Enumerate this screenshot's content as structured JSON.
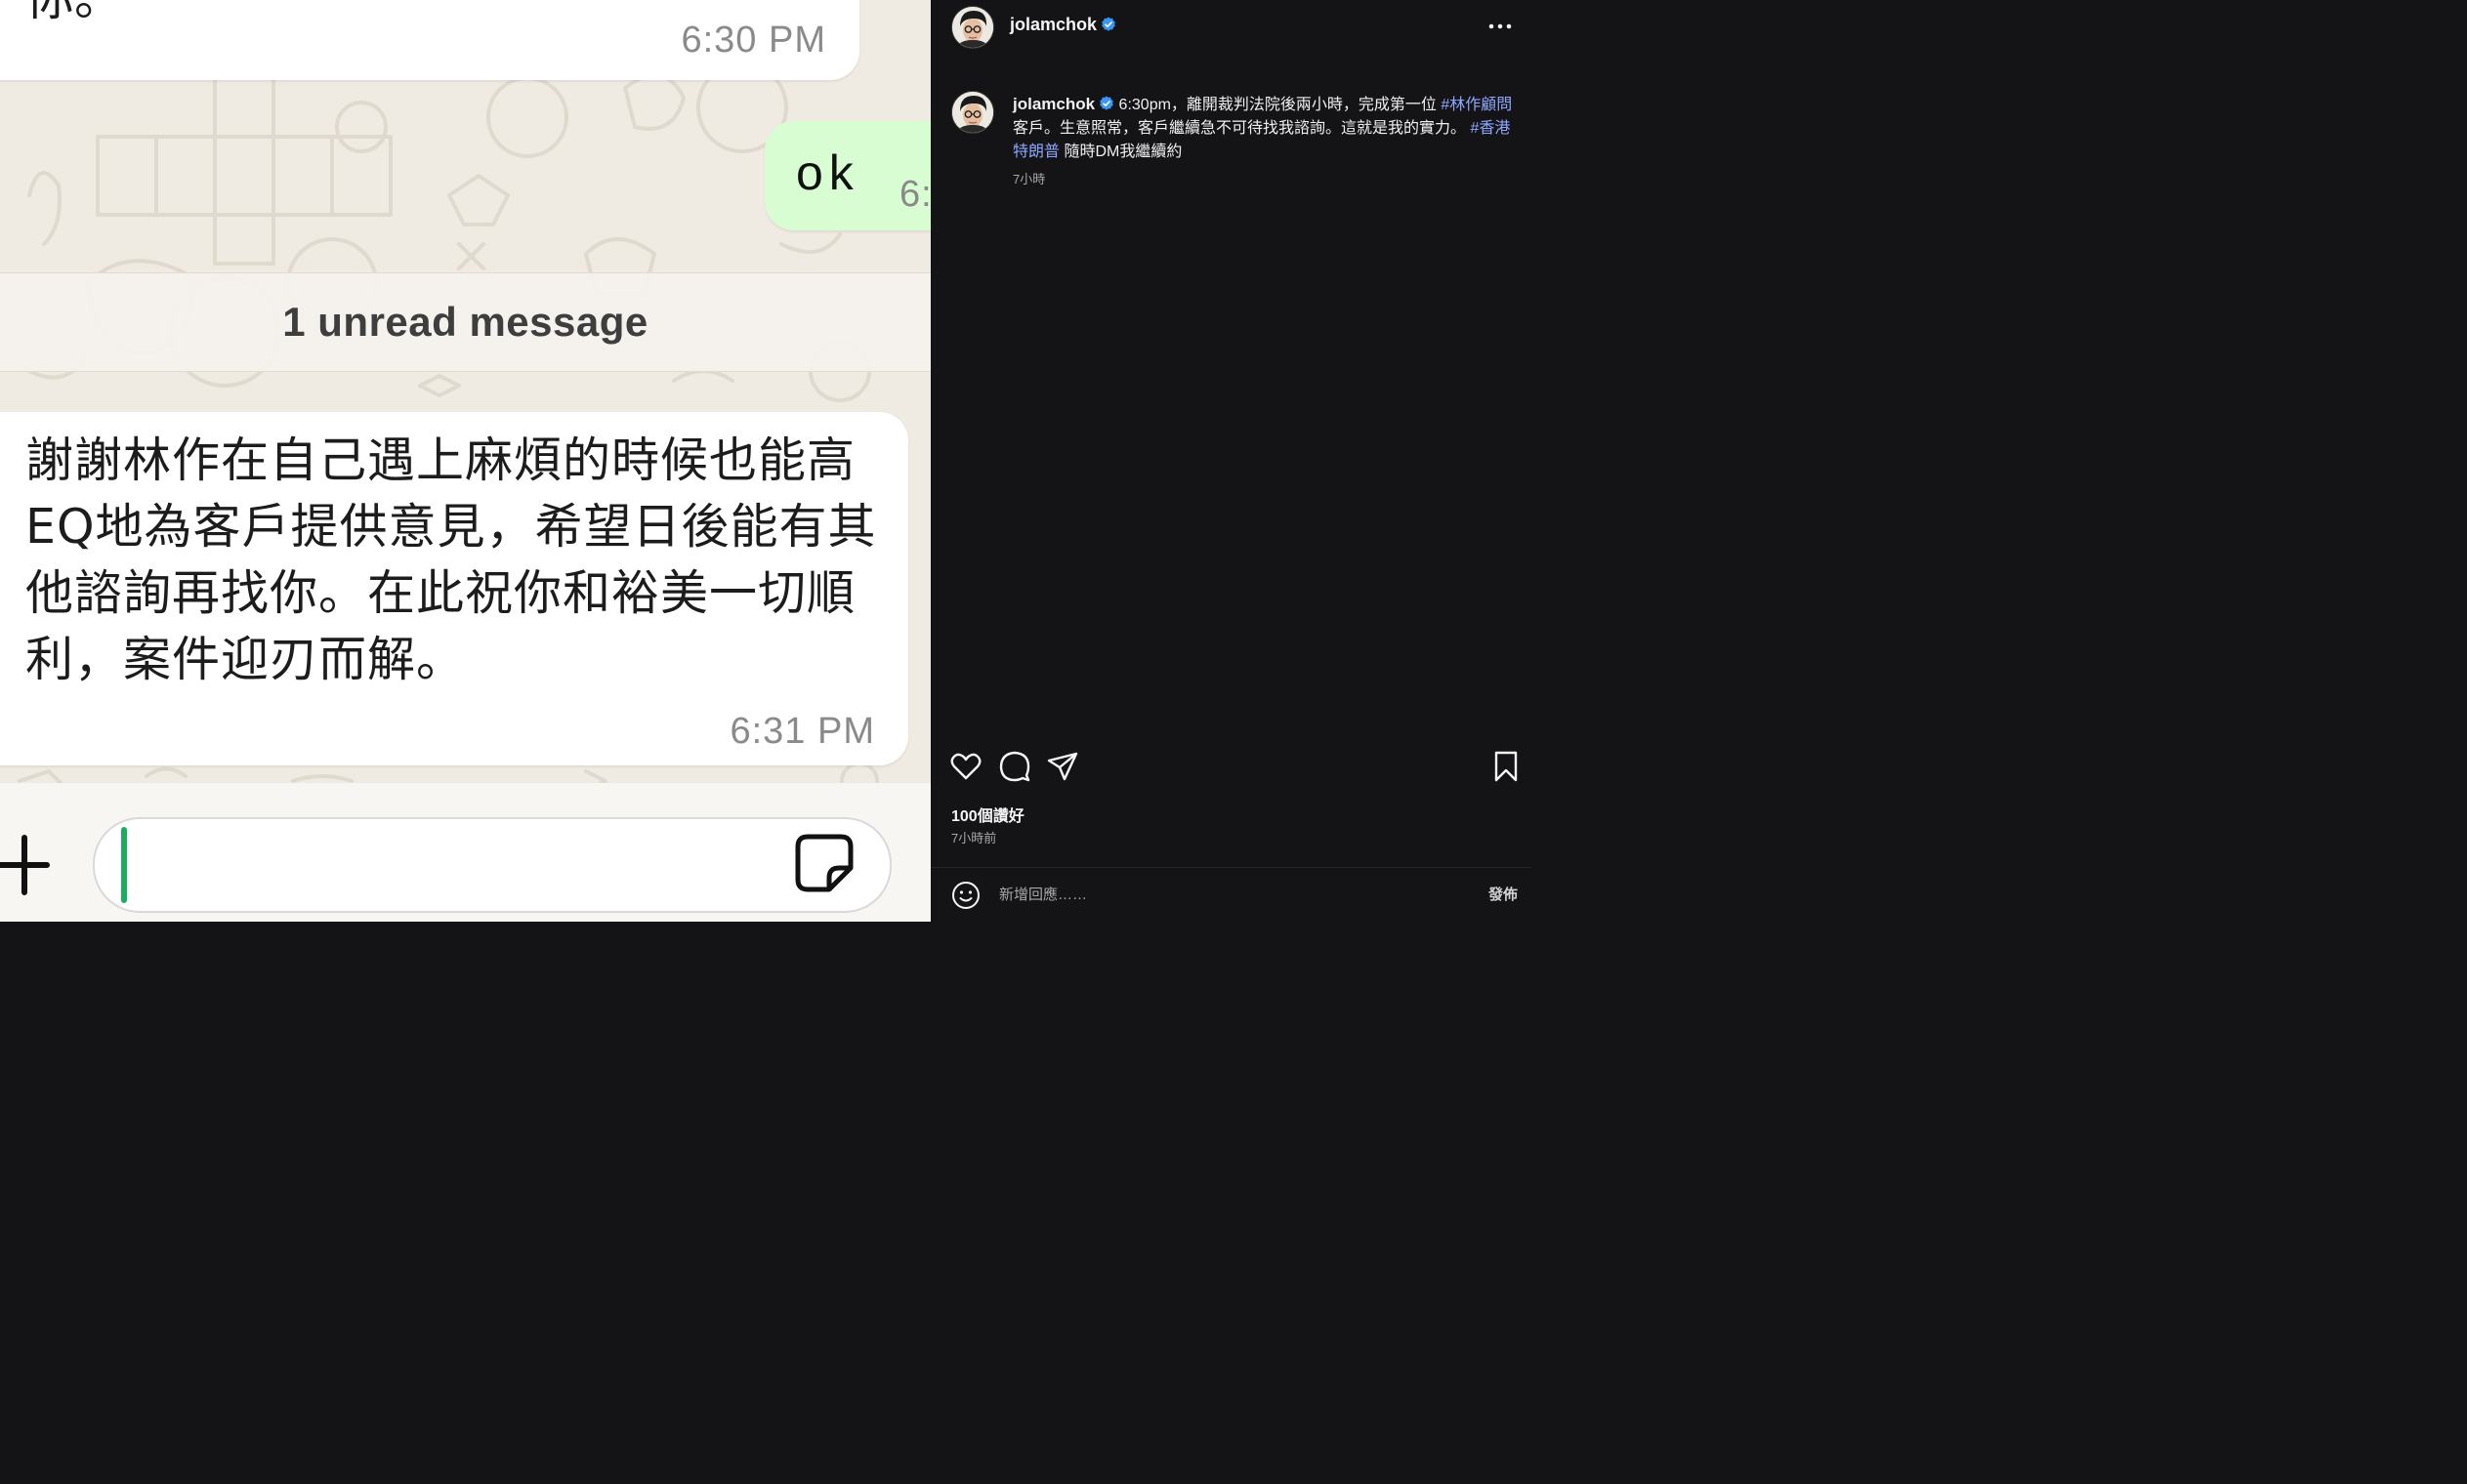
{
  "chat": {
    "top_message": {
      "text": "你。",
      "time": "6:30 PM"
    },
    "sent_message": {
      "text": "ok",
      "time": "6:"
    },
    "unread_divider": "1 unread message",
    "received_message": {
      "text": "謝謝林作在自己遇上麻煩的時候也能高EQ地為客戶提供意見，希望日後能有其他諮詢再找你。在此祝你和裕美一切順利，案件迎刃而解。",
      "time": "6:31 PM"
    },
    "icons": {
      "attach": "plus-icon",
      "sticker": "sticker-icon"
    },
    "colors": {
      "background": "#efeae2",
      "sent_bubble": "#d9fdd3",
      "caret": "#1daa61"
    }
  },
  "instagram": {
    "header": {
      "username": "jolamchok",
      "verified": true
    },
    "caption": {
      "username": "jolamchok",
      "text_1": "6:30pm，離開裁判法院後兩小時，完成第一位 ",
      "hashtag_1": "#林作顧問",
      "text_2": " 客戶。生意照常，客戶繼續急不可待找我諮詢。這就是我的實力。 ",
      "hashtag_2": "#香港特朗普",
      "text_3": " 隨時DM我繼續約",
      "time": "7小時"
    },
    "likes": "100個讚好",
    "post_time": "7小時前",
    "comment": {
      "placeholder": "新增回應……",
      "post_label": "發佈"
    },
    "colors": {
      "background": "#141417",
      "hashtag": "#8ea6ff",
      "verified": "#3897f0"
    }
  }
}
